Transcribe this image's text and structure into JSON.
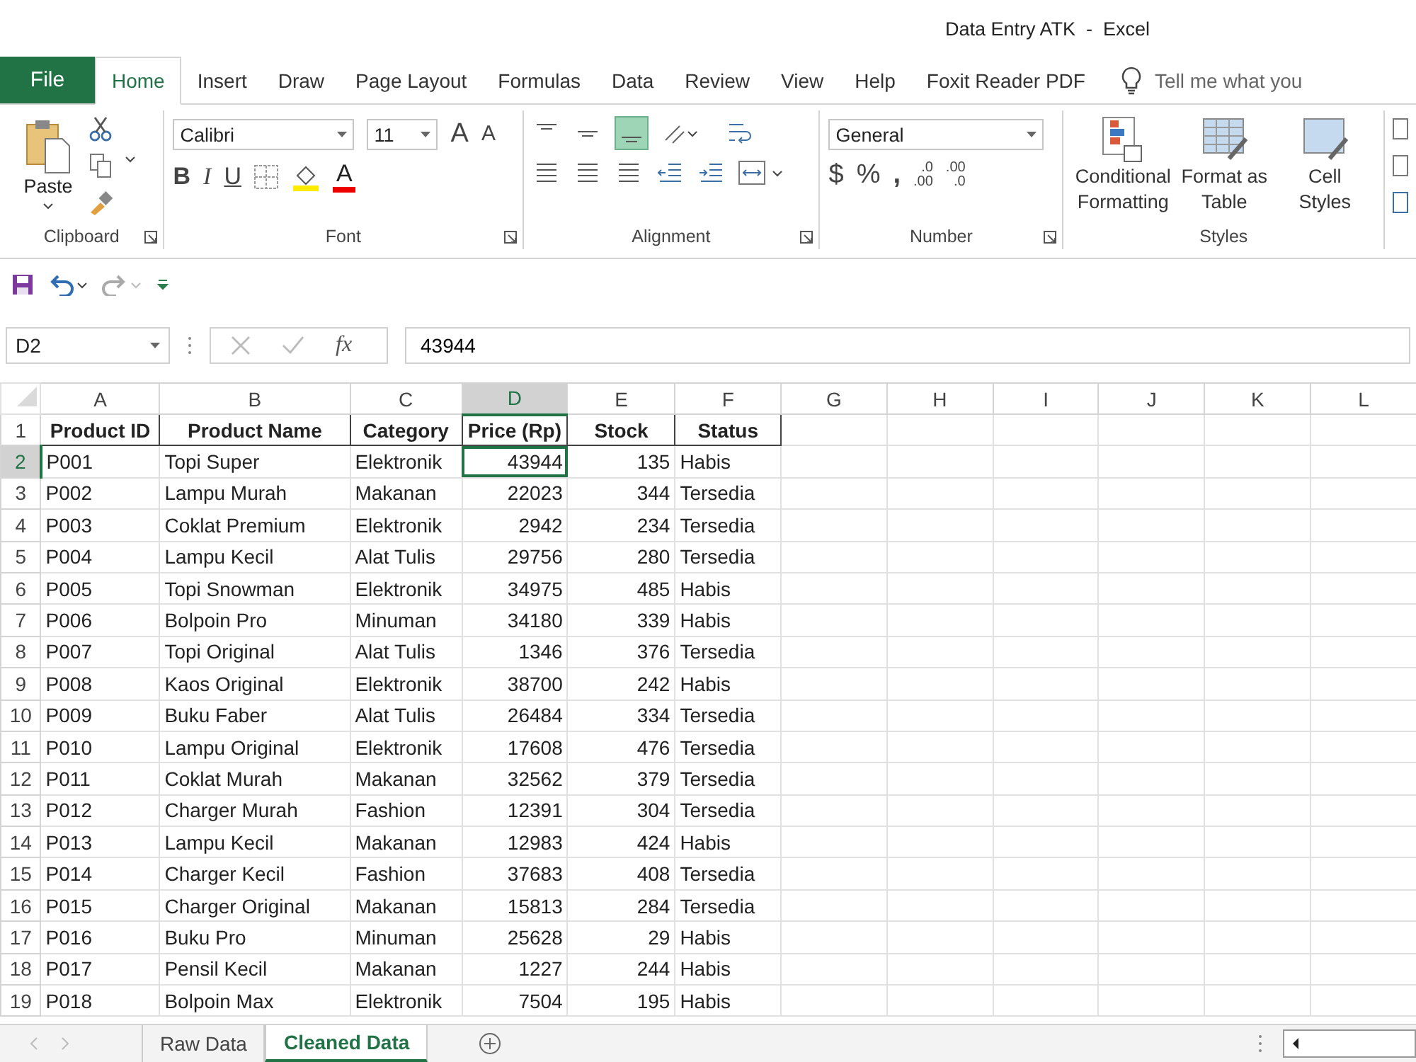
{
  "window": {
    "title": "Data Entry ATK  -  Excel"
  },
  "ribbon_tabs": [
    {
      "label": "File",
      "kind": "file",
      "selected": false
    },
    {
      "label": "Home",
      "kind": "tab",
      "selected": true
    },
    {
      "label": "Insert",
      "kind": "tab",
      "selected": false
    },
    {
      "label": "Draw",
      "kind": "tab",
      "selected": false
    },
    {
      "label": "Page Layout",
      "kind": "tab",
      "selected": false
    },
    {
      "label": "Formulas",
      "kind": "tab",
      "selected": false
    },
    {
      "label": "Data",
      "kind": "tab",
      "selected": false
    },
    {
      "label": "Review",
      "kind": "tab",
      "selected": false
    },
    {
      "label": "View",
      "kind": "tab",
      "selected": false
    },
    {
      "label": "Help",
      "kind": "tab",
      "selected": false
    },
    {
      "label": "Foxit Reader PDF",
      "kind": "tab",
      "selected": false
    }
  ],
  "tell_me": {
    "placeholder": "Tell me what you"
  },
  "clipboard": {
    "label": "Clipboard",
    "paste": "Paste"
  },
  "font": {
    "label": "Font",
    "name": "Calibri",
    "size": "11",
    "grow": "A",
    "shrink": "A",
    "bold": "B",
    "italic": "I",
    "underline": "U",
    "font_color": "A"
  },
  "alignment": {
    "label": "Alignment",
    "bottom_align_selected": true
  },
  "number": {
    "label": "Number",
    "format": "General",
    "currency": "$",
    "percent": "%",
    "comma": ",",
    "increase_decimal": [
      ".0",
      ".00"
    ],
    "decrease_decimal": [
      ".00",
      ".0"
    ]
  },
  "styles": {
    "label": "Styles",
    "buttons": [
      {
        "label": "Conditional Formatting",
        "kind": "conditional"
      },
      {
        "label": "Format as Table",
        "kind": "table"
      },
      {
        "label": "Cell Styles",
        "kind": "cell"
      }
    ]
  },
  "formula_bar": {
    "name_box": "D2",
    "fx": "fx",
    "value": "43944"
  },
  "sheet": {
    "columns": [
      {
        "letter": "A",
        "kind": "text",
        "selected": false
      },
      {
        "letter": "B",
        "kind": "text",
        "selected": false
      },
      {
        "letter": "C",
        "kind": "text",
        "selected": false
      },
      {
        "letter": "D",
        "kind": "number",
        "selected": true
      },
      {
        "letter": "E",
        "kind": "number",
        "selected": false
      },
      {
        "letter": "F",
        "kind": "text",
        "selected": false
      },
      {
        "letter": "G",
        "selected": false
      },
      {
        "letter": "H",
        "selected": false
      },
      {
        "letter": "I",
        "selected": false
      },
      {
        "letter": "J",
        "selected": false
      },
      {
        "letter": "K",
        "selected": false
      },
      {
        "letter": "L",
        "selected": false
      }
    ],
    "header_row_number": "1",
    "header": [
      "Product ID",
      "Product Name",
      "Category",
      "Price (Rp)",
      "Stock",
      "Status"
    ],
    "rows": [
      {
        "number": "2",
        "selected": true,
        "cells": [
          "P001",
          "Topi Super",
          "Elektronik",
          "43944",
          "135",
          "Habis"
        ]
      },
      {
        "number": "3",
        "selected": false,
        "cells": [
          "P002",
          "Lampu Murah",
          "Makanan",
          "22023",
          "344",
          "Tersedia"
        ]
      },
      {
        "number": "4",
        "selected": false,
        "cells": [
          "P003",
          "Coklat Premium",
          "Elektronik",
          "2942",
          "234",
          "Tersedia"
        ]
      },
      {
        "number": "5",
        "selected": false,
        "cells": [
          "P004",
          "Lampu Kecil",
          "Alat Tulis",
          "29756",
          "280",
          "Tersedia"
        ]
      },
      {
        "number": "6",
        "selected": false,
        "cells": [
          "P005",
          "Topi Snowman",
          "Elektronik",
          "34975",
          "485",
          "Habis"
        ]
      },
      {
        "number": "7",
        "selected": false,
        "cells": [
          "P006",
          "Bolpoin Pro",
          "Minuman",
          "34180",
          "339",
          "Habis"
        ]
      },
      {
        "number": "8",
        "selected": false,
        "cells": [
          "P007",
          "Topi Original",
          "Alat Tulis",
          "1346",
          "376",
          "Tersedia"
        ]
      },
      {
        "number": "9",
        "selected": false,
        "cells": [
          "P008",
          "Kaos Original",
          "Elektronik",
          "38700",
          "242",
          "Habis"
        ]
      },
      {
        "number": "10",
        "selected": false,
        "cells": [
          "P009",
          "Buku Faber",
          "Alat Tulis",
          "26484",
          "334",
          "Tersedia"
        ]
      },
      {
        "number": "11",
        "selected": false,
        "cells": [
          "P010",
          "Lampu Original",
          "Elektronik",
          "17608",
          "476",
          "Tersedia"
        ]
      },
      {
        "number": "12",
        "selected": false,
        "cells": [
          "P011",
          "Coklat Murah",
          "Makanan",
          "32562",
          "379",
          "Tersedia"
        ]
      },
      {
        "number": "13",
        "selected": false,
        "cells": [
          "P012",
          "Charger Murah",
          "Fashion",
          "12391",
          "304",
          "Tersedia"
        ]
      },
      {
        "number": "14",
        "selected": false,
        "cells": [
          "P013",
          "Lampu Kecil",
          "Makanan",
          "12983",
          "424",
          "Habis"
        ]
      },
      {
        "number": "15",
        "selected": false,
        "cells": [
          "P014",
          "Charger Kecil",
          "Fashion",
          "37683",
          "408",
          "Tersedia"
        ]
      },
      {
        "number": "16",
        "selected": false,
        "cells": [
          "P015",
          "Charger Original",
          "Makanan",
          "15813",
          "284",
          "Tersedia"
        ]
      },
      {
        "number": "17",
        "selected": false,
        "cells": [
          "P016",
          "Buku Pro",
          "Minuman",
          "25628",
          "29",
          "Habis"
        ]
      },
      {
        "number": "18",
        "selected": false,
        "cells": [
          "P017",
          "Pensil Kecil",
          "Makanan",
          "1227",
          "244",
          "Habis"
        ]
      },
      {
        "number": "19",
        "selected": false,
        "cells": [
          "P018",
          "Bolpoin Max",
          "Elektronik",
          "7504",
          "195",
          "Habis"
        ]
      }
    ]
  },
  "sheet_tabs": [
    {
      "label": "Raw Data",
      "selected": false
    },
    {
      "label": "Cleaned Data",
      "selected": true
    }
  ]
}
